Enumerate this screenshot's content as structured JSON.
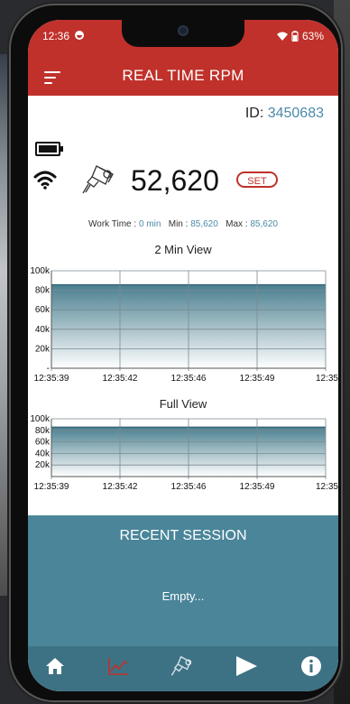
{
  "status_bar": {
    "time": "12:36",
    "battery": "63%"
  },
  "header": {
    "title": "REAL TIME RPM"
  },
  "device": {
    "id_label": "ID: ",
    "id_value": "3450683"
  },
  "rpm": {
    "value": "52,620",
    "set_label": "SET"
  },
  "stats": {
    "work_time_label": "Work Time : ",
    "work_time_value": "0 min",
    "min_label": "Min : ",
    "min_value": "85,620",
    "max_label": "Max : ",
    "max_value": "85,620"
  },
  "chart_data": [
    {
      "type": "area",
      "title": "2 Min View",
      "x": [
        "12:35:39",
        "12:35:42",
        "12:35:46",
        "12:35:49",
        "12:35"
      ],
      "series": [
        {
          "values": [
            85620,
            85620,
            85620,
            85620,
            85620
          ]
        }
      ],
      "yticks": [
        "100k",
        "80k",
        "60k",
        "40k",
        "20k",
        "-"
      ],
      "ylim": [
        0,
        100000
      ],
      "grid": true
    },
    {
      "type": "area",
      "title": "Full View",
      "x": [
        "12:35:39",
        "12:35:42",
        "12:35:46",
        "12:35:49",
        "12:35"
      ],
      "series": [
        {
          "values": [
            85620,
            85620,
            85620,
            85620,
            85620
          ]
        }
      ],
      "yticks": [
        "100k",
        "80k",
        "60k",
        "40k",
        "20k"
      ],
      "ylim": [
        0,
        100000
      ],
      "grid": true
    }
  ],
  "recent": {
    "title": "RECENT SESSION",
    "empty_text": "Empty..."
  },
  "colors": {
    "primary": "#c0312b",
    "accent": "#4b8aa8",
    "panel": "#4a8599",
    "nav": "#3d7284",
    "area_top": "#4a7f8f"
  },
  "nav": [
    "home-icon",
    "chart-icon",
    "spindle-icon",
    "play-icon",
    "info-icon"
  ]
}
